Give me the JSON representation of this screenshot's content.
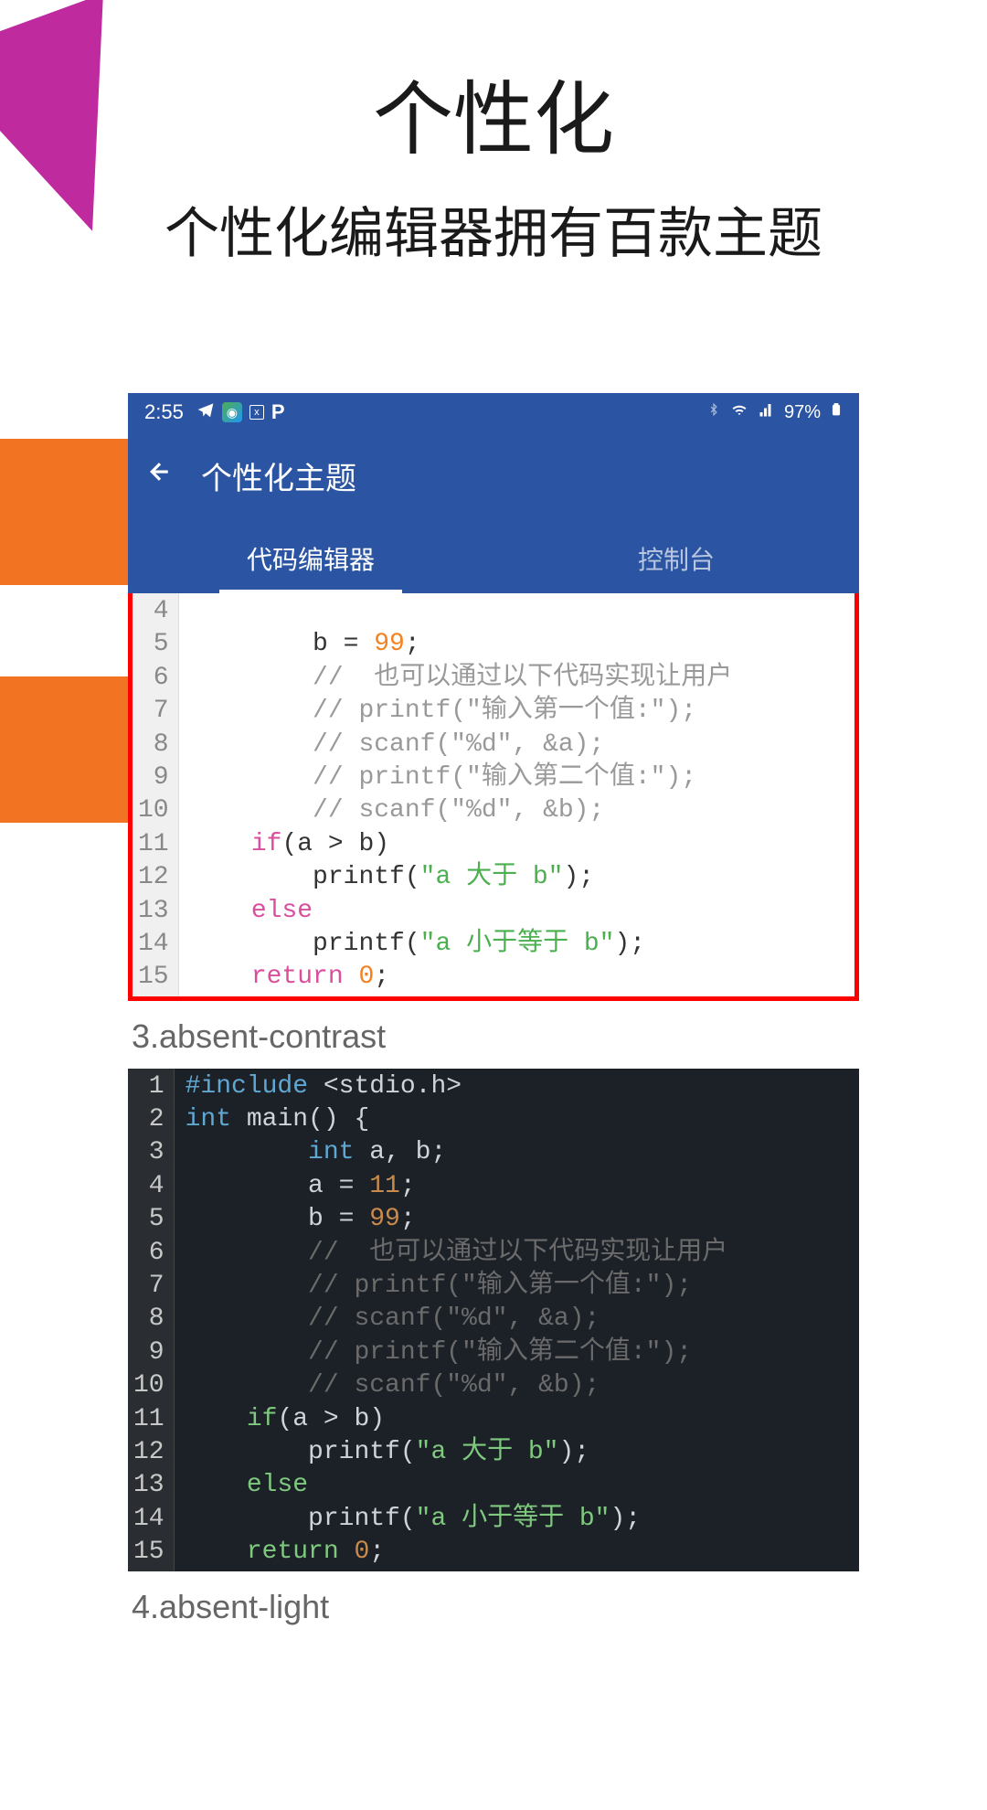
{
  "page": {
    "title": "个性化",
    "subtitle": "个性化编辑器拥有百款主题"
  },
  "status_bar": {
    "time": "2:55",
    "battery": "97%"
  },
  "app_bar": {
    "title": "个性化主题"
  },
  "tabs": {
    "active": "代码编辑器",
    "inactive": "控制台"
  },
  "theme_labels": {
    "third": "3.absent-contrast",
    "fourth": "4.absent-light"
  },
  "code_light": {
    "gutter": [
      "4",
      "5",
      "6",
      "7",
      "8",
      "9",
      "10",
      "11",
      "12",
      "13",
      "14",
      "15"
    ],
    "line4_prefix": "        ",
    "line5_indent": "        b = ",
    "line5_num": "99",
    "line5_end": ";",
    "line6": "        //  也可以通过以下代码实现让用户",
    "line7": "        // printf(\"输入第一个值:\");",
    "line8": "        // scanf(\"%d\", &a);",
    "line9": "        // printf(\"输入第二个值:\");",
    "line10": "        // scanf(\"%d\", &b);",
    "line11_indent": "    ",
    "line11_kw": "if",
    "line11_rest": "(a > b)",
    "line12_indent": "        printf(",
    "line12_str": "\"a 大于 b\"",
    "line12_end": ");",
    "line13_indent": "    ",
    "line13_kw": "else",
    "line14_indent": "        printf(",
    "line14_str": "\"a 小于等于 b\"",
    "line14_end": ");",
    "line15_indent": "    ",
    "line15_kw": "return",
    "line15_sp": " ",
    "line15_num": "0",
    "line15_end": ";"
  },
  "code_dark": {
    "gutter": [
      "1",
      "2",
      "3",
      "4",
      "5",
      "6",
      "7",
      "8",
      "9",
      "10",
      "11",
      "12",
      "13",
      "14",
      "15"
    ],
    "line1_a": "#include",
    "line1_b": " <stdio.h>",
    "line2_a": "int",
    "line2_b": " main() {",
    "line3_indent": "        ",
    "line3_kw": "int",
    "line3_rest": " a, b;",
    "line4_indent": "        a = ",
    "line4_num": "11",
    "line4_end": ";",
    "line5_indent": "        b = ",
    "line5_num": "99",
    "line5_end": ";",
    "line6": "        //  也可以通过以下代码实现让用户",
    "line7": "        // printf(\"输入第一个值:\");",
    "line8": "        // scanf(\"%d\", &a);",
    "line9": "        // printf(\"输入第二个值:\");",
    "line10": "        // scanf(\"%d\", &b);",
    "line11_indent": "    ",
    "line11_kw": "if",
    "line11_rest": "(a > b)",
    "line12_indent": "        printf(",
    "line12_str": "\"a 大于 b\"",
    "line12_end": ");",
    "line13_indent": "    ",
    "line13_kw": "else",
    "line14_indent": "        printf(",
    "line14_str": "\"a 小于等于 b\"",
    "line14_end": ");",
    "line15_indent": "    ",
    "line15_kw": "return",
    "line15_sp": " ",
    "line15_num": "0",
    "line15_end": ";"
  }
}
